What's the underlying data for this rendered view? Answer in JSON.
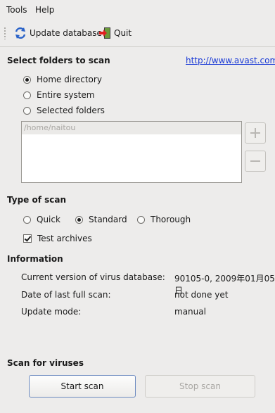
{
  "menu": {
    "tools": "Tools",
    "help": "Help"
  },
  "toolbar": {
    "update_label": "Update database",
    "quit_label": "Quit"
  },
  "folders": {
    "heading": "Select folders to scan",
    "link": "http://www.avast.com",
    "options": [
      "Home directory",
      "Entire system",
      "Selected folders"
    ],
    "selected_option": "Home directory",
    "list_items": [
      "/home/naitou"
    ]
  },
  "scan_type": {
    "heading": "Type of scan",
    "options": [
      "Quick",
      "Standard",
      "Thorough"
    ],
    "selected_option": "Standard",
    "test_archives_label": "Test archives",
    "test_archives_checked": true
  },
  "information": {
    "heading": "Information",
    "rows": [
      {
        "label": "Current version of virus database:",
        "value": "90105-0, 2009年01月05日"
      },
      {
        "label": "Date of last full scan:",
        "value": "not done yet"
      },
      {
        "label": "Update mode:",
        "value": "manual"
      }
    ]
  },
  "scan": {
    "heading": "Scan for viruses",
    "start_label": "Start scan",
    "stop_label": "Stop scan"
  },
  "colors": {
    "link": "#1a3ad6",
    "quit_arrow": "#e02020",
    "refresh_icon": "#2a62c8"
  }
}
